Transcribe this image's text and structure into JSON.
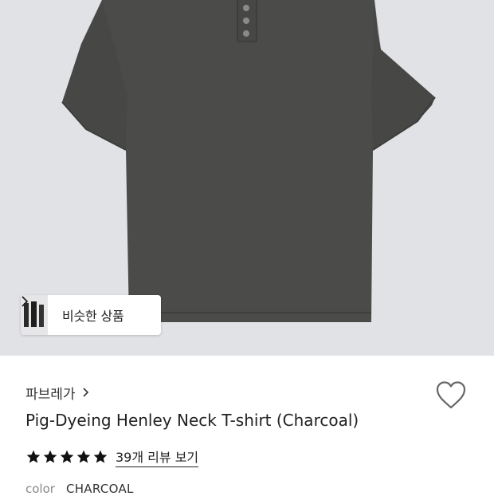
{
  "product": {
    "brand": "파브레가",
    "title": "Pig-Dyeing Henley Neck T-shirt (Charcoal)",
    "rating": 5,
    "review_link": "39개 리뷰 보기",
    "color_label": "color",
    "color_value": "CHARCOAL"
  },
  "hero": {
    "similar_label": "비슷한 상품"
  },
  "icons": {
    "similar_chevron": "chevron-right-icon",
    "brand_chevron": "chevron-right-icon",
    "wishlist": "heart-icon",
    "star": "star-icon"
  },
  "colors": {
    "hero_bg": "#e1e2e6",
    "shirt": "#4b4b4a",
    "star": "#111111"
  }
}
